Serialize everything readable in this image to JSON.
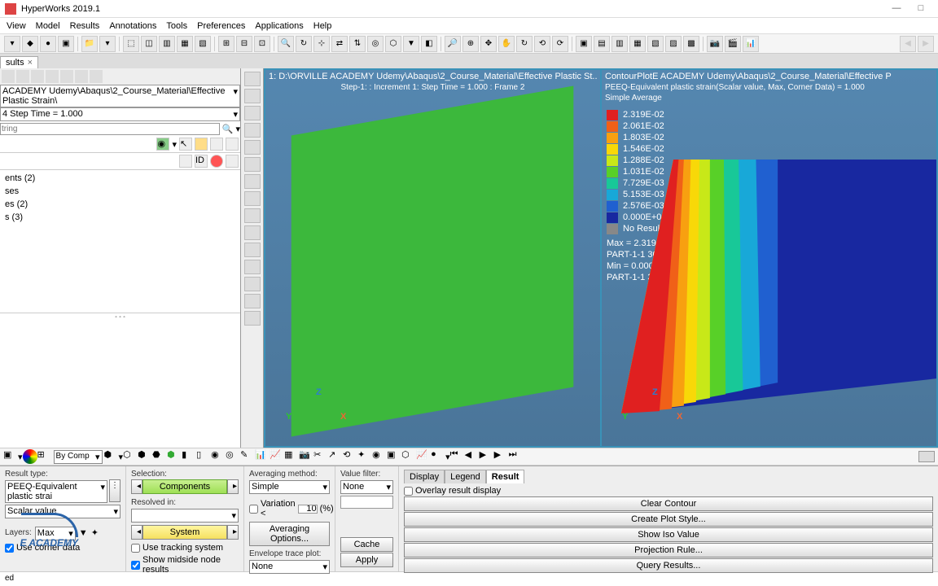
{
  "title": "HyperWorks 2019.1",
  "menus": [
    "View",
    "Model",
    "Results",
    "Annotations",
    "Tools",
    "Preferences",
    "Applications",
    "Help"
  ],
  "tab": "sults",
  "path_combo": "ACADEMY Udemy\\Abaqus\\2_Course_Material\\Effective Plastic Strain\\",
  "step_combo": "4 Step Time =     1.000",
  "filter_placeholder": "tring",
  "tree_items": [
    "ents (2)",
    "ses",
    "es (2)",
    "",
    "s (3)",
    ""
  ],
  "vp_left_title": "1: D:\\ORVILLE ACADEMY Udemy\\Abaqus\\2_Course_Material\\Effective Plastic St...",
  "vp_left_sub": "Step-1: : Increment     1: Step Time =     1.000 : Frame 2",
  "vp_right_title": "ContourPlotE ACADEMY Udemy\\Abaqus\\2_Course_Material\\Effective P",
  "vp_right_sub": "PEEQ-Equivalent plastic strain(Scalar value, Max, Corner Data) =   1.000",
  "vp_right_sub2": "Simple Average",
  "legend": [
    {
      "c": "#e02020",
      "v": "2.319E-02"
    },
    {
      "c": "#f06018",
      "v": "2.061E-02"
    },
    {
      "c": "#f8a010",
      "v": "1.803E-02"
    },
    {
      "c": "#f8d808",
      "v": "1.546E-02"
    },
    {
      "c": "#c8e818",
      "v": "1.288E-02"
    },
    {
      "c": "#58d028",
      "v": "1.031E-02"
    },
    {
      "c": "#18c898",
      "v": "7.729E-03"
    },
    {
      "c": "#18a8d8",
      "v": "5.153E-03"
    },
    {
      "c": "#2060d0",
      "v": "2.576E-03"
    },
    {
      "c": "#1828a0",
      "v": "0.000E+00"
    }
  ],
  "legend_noresult": "No Result",
  "legend_max": "Max =  2.319E-02",
  "legend_maxp": "PART-1-1 30",
  "legend_min": "Min =  0.000E+00",
  "legend_minp": "PART-1-1 3",
  "panel": {
    "result_type_label": "Result type:",
    "result_type": "PEEQ-Equivalent plastic strai",
    "scalar": "Scalar value",
    "layers_label": "Layers:",
    "layers": "Max",
    "use_corner": "Use corner data",
    "selection_label": "Selection:",
    "components": "Components",
    "resolved_label": "Resolved in:",
    "system": "System",
    "use_tracking": "Use tracking system",
    "show_midside": "Show midside node results",
    "avg_label": "Averaging method:",
    "avg": "Simple",
    "variation": "Variation <",
    "variation_val": "10",
    "variation_pct": "(%)",
    "avg_opt": "Averaging Options...",
    "env_label": "Envelope trace plot:",
    "env": "None",
    "value_filter_label": "Value filter:",
    "value_filter": "None",
    "cache": "Cache",
    "apply": "Apply",
    "tabs": [
      "Display",
      "Legend",
      "Result"
    ],
    "overlay": "Overlay result display",
    "clear": "Clear Contour",
    "create_plot": "Create Plot Style...",
    "show_iso": "Show Iso Value",
    "proj": "Projection Rule...",
    "query": "Query Results..."
  },
  "status": "ed"
}
